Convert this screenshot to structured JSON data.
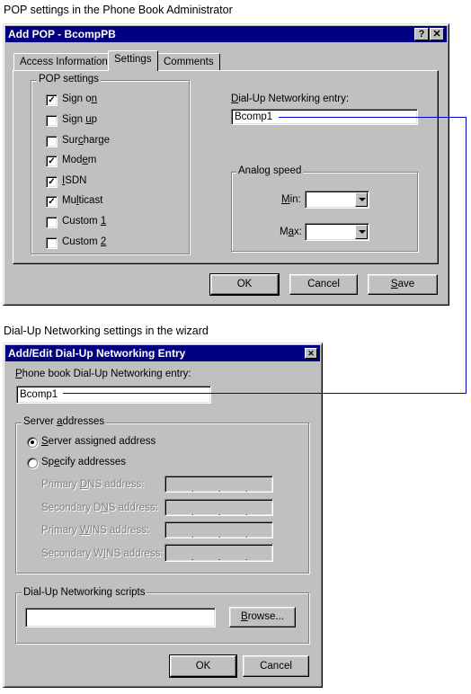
{
  "captions": {
    "top": "POP settings in the Phone Book Administrator",
    "bottom": "Dial-Up Networking settings in the wizard"
  },
  "pop_dialog": {
    "title": "Add POP -  BcompPB",
    "help_button": "?",
    "close_button": "✕",
    "tabs": [
      {
        "label": "Access Information",
        "active": false
      },
      {
        "label": "Settings",
        "active": true
      },
      {
        "label": "Comments",
        "active": false
      }
    ],
    "pop_settings": {
      "label": "POP settings",
      "items": [
        {
          "label": "Sign on",
          "checked": true
        },
        {
          "label": "Sign up",
          "checked": false
        },
        {
          "label": "Surcharge",
          "checked": false
        },
        {
          "label": "Modem",
          "checked": true
        },
        {
          "label": "ISDN",
          "checked": true
        },
        {
          "label": "Multicast",
          "checked": true
        },
        {
          "label": "Custom 1",
          "checked": false
        },
        {
          "label": "Custom 2",
          "checked": false
        }
      ]
    },
    "dun_entry": {
      "label": "Dial-Up Networking entry:",
      "value": "Bcomp1"
    },
    "analog_speed": {
      "label": "Analog speed",
      "min_label": "Min:",
      "min_value": "",
      "max_label": "Max:",
      "max_value": ""
    },
    "buttons": {
      "ok": "OK",
      "cancel": "Cancel",
      "save": "Save"
    }
  },
  "dun_dialog": {
    "title": "Add/Edit Dial-Up Networking Entry",
    "close_button": "✕",
    "entry": {
      "label": "Phone book Dial-Up Networking entry:",
      "value": "Bcomp1"
    },
    "server_addresses": {
      "label": "Server addresses",
      "options": [
        {
          "label": "Server assigned address",
          "selected": true
        },
        {
          "label": "Specify addresses",
          "selected": false
        }
      ],
      "fields": [
        {
          "label": "Primary DNS address:",
          "value": [
            "",
            "",
            "",
            ""
          ]
        },
        {
          "label": "Secondary DNS address:",
          "value": [
            "",
            "",
            "",
            ""
          ]
        },
        {
          "label": "Primary WINS address:",
          "value": [
            "",
            "",
            "",
            ""
          ]
        },
        {
          "label": "Secondary WINS address:",
          "value": [
            "",
            "",
            "",
            ""
          ]
        }
      ],
      "ip_separator": "."
    },
    "scripts": {
      "label": "Dial-Up Networking scripts",
      "value": "",
      "browse_button": "Browse..."
    },
    "buttons": {
      "ok": "OK",
      "cancel": "Cancel"
    }
  },
  "colors": {
    "title_bar": "#000080",
    "dialog_face": "#c0c0c0",
    "connector_line": "#0000c8"
  }
}
